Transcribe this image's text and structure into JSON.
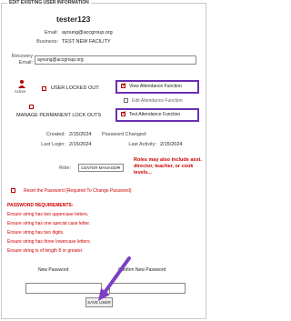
{
  "section": {
    "legend": "EDIT EXISTING USER INFORMATION"
  },
  "user": {
    "username": "tester123",
    "email_label": "Email:",
    "email_value": "ayoung@accgroup.org",
    "business_label": "Business:",
    "business_value": "TEST NEW FACILITY"
  },
  "recovery": {
    "label_line1": "Recovery",
    "label_line2": "Email:",
    "value": "ayoung@accgroup.org"
  },
  "flags": {
    "active_label": "Active",
    "locked_label": "USER LOCKED OUT:",
    "manage_lockouts_label": "MANAGE PERMANENT LOCK OUTS",
    "view_attendance_label": "View Attendance Function",
    "view_attendance_checked": true,
    "edit_attendance_label": "Edit Attendance Function",
    "edit_attendance_checked": false,
    "test_attendance_label": "Test Attendance Function",
    "test_attendance_checked": true
  },
  "dates": {
    "created_label": "Created:",
    "created_value": "2/15/2024",
    "password_changed_label": "Password Changed:",
    "password_changed_value": "",
    "last_login_label": "Last Login:",
    "last_login_value": "2/15/2024",
    "last_activity_label": "Last Activity:",
    "last_activity_value": "2/15/2024"
  },
  "role": {
    "label": "Role:",
    "selected": "CENTER MANAGER",
    "note": "Roles may also include asst. director, teacher, or cook levels..."
  },
  "reset": {
    "label": "Reset the Password (Required To Change Password)"
  },
  "requirements": {
    "title": "PASSWORD REQUIREMENTS:",
    "items": [
      "Ensure string has two uppercase letters.",
      "Ensure string has one special case letter.",
      "Ensure string has two digits.",
      "Ensure string has three lowercase letters.",
      "Ensure string is of length 8 or greater."
    ]
  },
  "password": {
    "new_label": "New Password",
    "confirm_label": "Confirm New Password",
    "new_value": "",
    "confirm_value": ""
  },
  "actions": {
    "save_label": "SAVE USER"
  },
  "colors": {
    "highlight": "#6a2fb3",
    "alert_red": "#cc0000",
    "arrow": "#7a3fc4"
  }
}
